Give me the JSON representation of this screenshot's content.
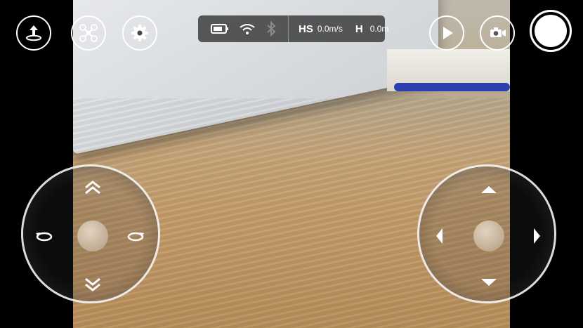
{
  "top_left_buttons": [
    {
      "name": "takeoff-landing-button",
      "icon": "takeoff-arrow-icon"
    },
    {
      "name": "drone-mode-button",
      "icon": "quadcopter-icon"
    },
    {
      "name": "settings-button",
      "icon": "gear-icon"
    }
  ],
  "status_bar": {
    "icons": [
      "battery-icon",
      "wifi-icon",
      "bluetooth-icon"
    ],
    "hs_label": "HS",
    "hs_value": "0.0m/s",
    "h_label": "H",
    "h_value": "0.0m"
  },
  "top_right_buttons": [
    {
      "name": "playback-button",
      "icon": "play-icon"
    },
    {
      "name": "camera-switch-button",
      "icon": "camera-switch-icon"
    },
    {
      "name": "shutter-button",
      "icon": "shutter-icon"
    }
  ],
  "left_joystick": {
    "controls": [
      "ascend-arrow-icon",
      "descend-arrow-icon",
      "rotate-left-icon",
      "rotate-right-icon"
    ]
  },
  "right_joystick": {
    "controls": [
      "forward-arrow-icon",
      "backward-arrow-icon",
      "left-arrow-icon",
      "right-arrow-icon"
    ]
  }
}
